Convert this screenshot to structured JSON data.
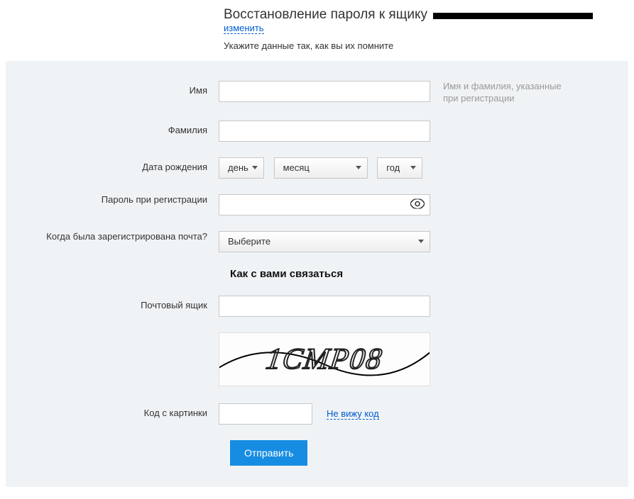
{
  "header": {
    "title_prefix": "Восстановление пароля к ящику",
    "change_link": "изменить",
    "subtitle": "Укажите данные так, как вы их помните"
  },
  "form": {
    "first_name": {
      "label": "Имя",
      "hint": "Имя и фамилия, указанные при регистрации"
    },
    "last_name": {
      "label": "Фамилия"
    },
    "dob": {
      "label": "Дата рождения",
      "day_placeholder": "день",
      "month_placeholder": "месяц",
      "year_placeholder": "год"
    },
    "password": {
      "label": "Пароль при регистрации"
    },
    "when_registered": {
      "label": "Когда была зарегистрирована почта?",
      "placeholder": "Выберите"
    },
    "contact_section_title": "Как с вами связаться",
    "mailbox": {
      "label": "Почтовый ящик"
    },
    "captcha": {
      "image_text": "1CMP08",
      "code_label": "Код с картинки",
      "cant_see_link": "Не вижу код"
    },
    "submit_label": "Отправить"
  }
}
